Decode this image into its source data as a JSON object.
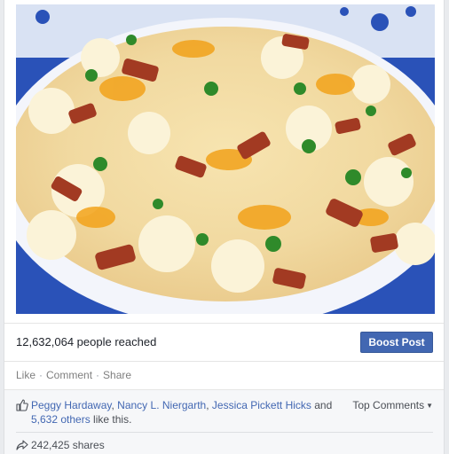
{
  "post": {
    "photo_description_icon": "food-photo"
  },
  "reach": {
    "text": "12,632,064 people reached",
    "boost_label": "Boost Post"
  },
  "actions": {
    "like": "Like",
    "comment": "Comment",
    "share": "Share",
    "separator": "·"
  },
  "likes": {
    "names": [
      "Peggy Hardaway",
      "Nancy L. Niergarth",
      "Jessica Pickett Hicks"
    ],
    "sep1": ", ",
    "sep2": ", ",
    "and": " and ",
    "others": "5,632 others",
    "suffix": " like this.",
    "top_comments": "Top Comments"
  },
  "shares": {
    "text": "242,425 shares"
  },
  "colors": {
    "link": "#4267b2",
    "boost_bg": "#4267b2"
  }
}
